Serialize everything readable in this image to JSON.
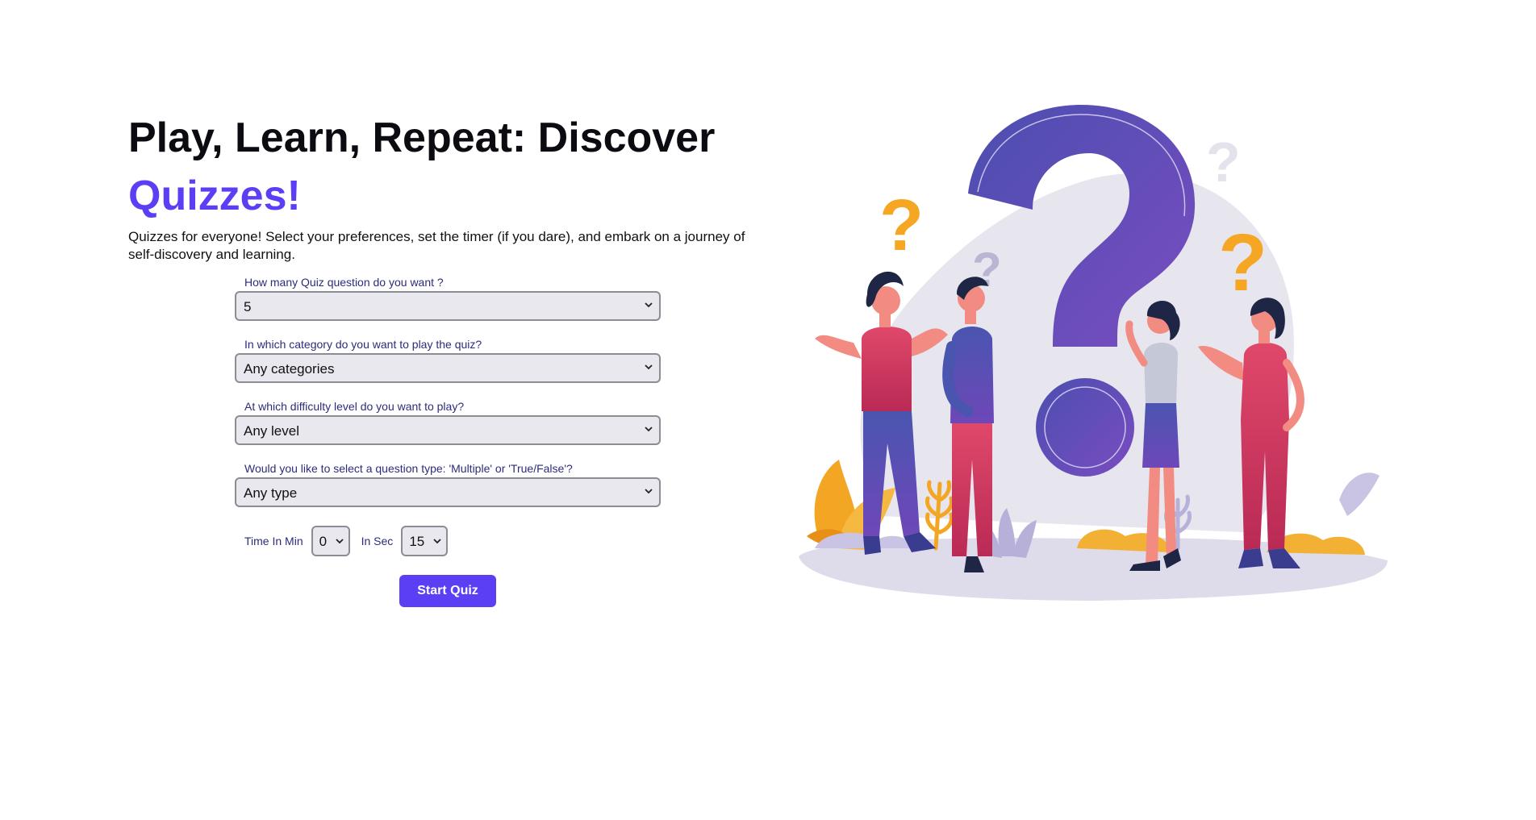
{
  "hero": {
    "title": "Play, Learn, Repeat: Discover",
    "title_accent": "Quizzes!",
    "intro": "Quizzes for everyone! Select your preferences, set the timer (if you dare), and embark on a journey of self-discovery and learning."
  },
  "form": {
    "amount": {
      "label": "How many Quiz question do you want ?",
      "value": "5"
    },
    "category": {
      "label": "In which category do you want to play the quiz?",
      "value": "Any categories"
    },
    "difficulty": {
      "label": "At which difficulty level do you want to play?",
      "value": "Any level"
    },
    "type": {
      "label": "Would you like to select a question type: 'Multiple' or 'True/False'?",
      "value": "Any type"
    },
    "timer": {
      "min_label": "Time In Min",
      "min_value": "0",
      "sec_label": "In Sec",
      "sec_value": "15"
    },
    "start_label": "Start Quiz"
  },
  "colors": {
    "accent": "#5b3ff5",
    "label": "#2c2c7a",
    "question_mark": "#5a4bc4",
    "orange": "#f5a623"
  },
  "icons": {
    "dropdown": "chevron-down-icon",
    "illustration": "people-question-marks-illustration"
  }
}
